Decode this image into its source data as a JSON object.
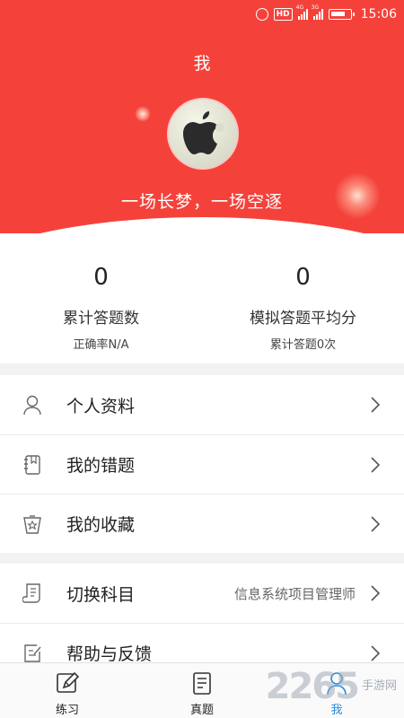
{
  "status_bar": {
    "time": "15:06",
    "hd": "HD",
    "signal1": "4G",
    "signal2": "3G"
  },
  "header": {
    "title": "我",
    "motto": "一场长梦，一场空逐"
  },
  "stats": [
    {
      "value": "0",
      "label": "累计答题数",
      "sub": "正确率N/A"
    },
    {
      "value": "0",
      "label": "模拟答题平均分",
      "sub": "累计答题0次"
    }
  ],
  "menu": {
    "group1": [
      {
        "label": "个人资料",
        "icon": "user-icon"
      },
      {
        "label": "我的错题",
        "icon": "notebook-icon"
      },
      {
        "label": "我的收藏",
        "icon": "star-icon"
      }
    ],
    "group2": [
      {
        "label": "切换科目",
        "icon": "scroll-icon",
        "value": "信息系统项目管理师"
      },
      {
        "label": "帮助与反馈",
        "icon": "edit-icon"
      }
    ]
  },
  "tabs": [
    {
      "label": "练习",
      "icon": "pencil-icon"
    },
    {
      "label": "真题",
      "icon": "document-icon"
    },
    {
      "label": "我",
      "icon": "person-icon",
      "active": true
    }
  ],
  "watermark": {
    "number": "2265",
    "text": "手游网"
  },
  "colors": {
    "primary": "#f4423b",
    "active_tab": "#2a8ae0"
  }
}
